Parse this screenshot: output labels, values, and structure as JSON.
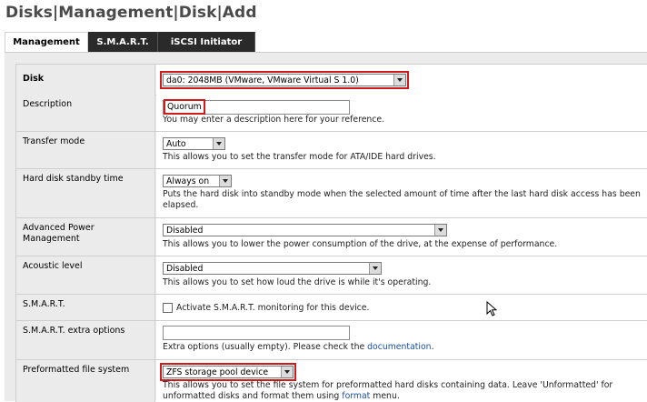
{
  "page": {
    "title": "Disks|Management|Disk|Add"
  },
  "tabs": [
    {
      "label": "Management",
      "active": true
    },
    {
      "label": "S.M.A.R.T.",
      "active": false
    },
    {
      "label": "iSCSI Initiator",
      "active": false
    }
  ],
  "form": {
    "disk": {
      "label": "Disk",
      "value": "da0: 2048MB (VMware, VMware Virtual S 1.0)"
    },
    "description": {
      "label": "Description",
      "value": "Quorum",
      "help": "You may enter a description here for your reference."
    },
    "transfer_mode": {
      "label": "Transfer mode",
      "value": "Auto",
      "help": "This allows you to set the transfer mode for ATA/IDE hard drives."
    },
    "standby": {
      "label": "Hard disk standby time",
      "value": "Always on",
      "help": "Puts the hard disk into standby mode when the selected amount of time after the last hard disk access has been elapsed."
    },
    "apm": {
      "label": "Advanced Power Management",
      "value": "Disabled",
      "help": "This allows you to lower the power consumption of the drive, at the expense of performance."
    },
    "acoustic": {
      "label": "Acoustic level",
      "value": "Disabled",
      "help": "This allows you to set how loud the drive is while it's operating."
    },
    "smart": {
      "label": "S.M.A.R.T.",
      "checkbox_label": "Activate S.M.A.R.T. monitoring for this device.",
      "checked": false
    },
    "smart_extra": {
      "label": "S.M.A.R.T. extra options",
      "value": "",
      "help_prefix": "Extra options (usually empty). Please check the ",
      "help_link": "documentation",
      "help_suffix": "."
    },
    "preformatted": {
      "label": "Preformatted file system",
      "value": "ZFS storage pool device",
      "help_prefix": "This allows you to set the file system for preformatted hard disks containing data. Leave 'Unformatted' for unformatted disks and format them using ",
      "help_link": "format",
      "help_suffix": " menu."
    }
  },
  "colors": {
    "highlight": "#d11a1a",
    "tab_bg": "#2a2a2a",
    "link": "#1a4fa3"
  }
}
